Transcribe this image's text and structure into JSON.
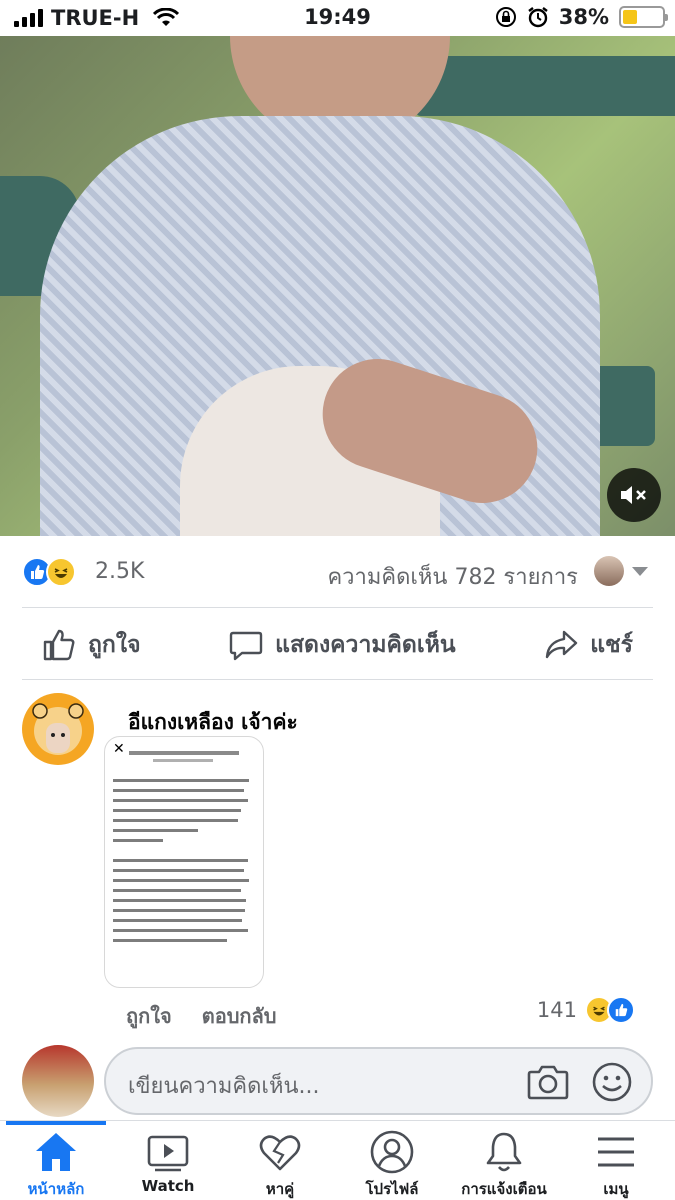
{
  "status_bar": {
    "carrier": "TRUE-H",
    "time": "19:49",
    "battery_percent": "38%",
    "battery_level": 0.38,
    "icons": [
      "signal-icon",
      "wifi-icon",
      "rotation-lock-icon",
      "alarm-icon",
      "battery-icon"
    ]
  },
  "post": {
    "reaction_count": "2.5K",
    "comment_count": "ความคิดเห็น 782 รายการ",
    "reactions": [
      "like",
      "haha"
    ],
    "actions": {
      "like_label": "ถูกใจ",
      "comment_label": "แสดงความคิดเห็น",
      "share_label": "แชร์"
    }
  },
  "comment": {
    "author": "อีแกงเหลือง เจ้าค่ะ",
    "like_label": "ถูกใจ",
    "reply_label": "ตอบกลับ",
    "reaction_count": "141",
    "reactions": [
      "haha",
      "like"
    ]
  },
  "composer": {
    "placeholder": "เขียนความคิดเห็น..."
  },
  "bottom_nav": {
    "items": [
      {
        "label": "หน้าหลัก",
        "icon": "home-icon",
        "active": true
      },
      {
        "label": "Watch",
        "icon": "watch-icon",
        "active": false
      },
      {
        "label": "หาคู่",
        "icon": "dating-heart-icon",
        "active": false
      },
      {
        "label": "โปรไฟล์",
        "icon": "profile-icon",
        "active": false
      },
      {
        "label": "การแจ้งเตือน",
        "icon": "bell-icon",
        "active": false
      },
      {
        "label": "เมนู",
        "icon": "menu-icon",
        "active": false
      }
    ]
  },
  "colors": {
    "brand_blue": "#1877f2",
    "haha_yellow": "#f7c62f",
    "battery_yellow": "#f5c518"
  }
}
